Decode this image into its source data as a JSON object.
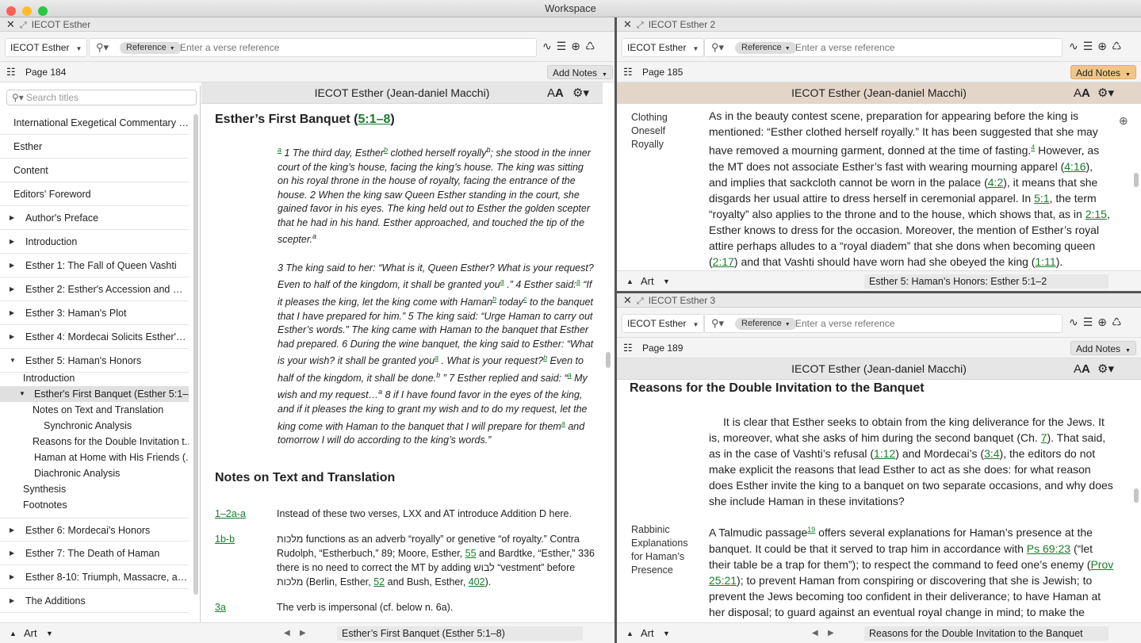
{
  "window": {
    "title": "Workspace"
  },
  "pane1": {
    "tab": "IECOT Esther",
    "resource": "IECOT Esther",
    "ref_pill": "Reference",
    "search_placeholder": "Enter a verse reference",
    "page": "Page 184",
    "add_notes": "Add Notes",
    "book_title": "IECOT Esther (Jean-daniel Macchi)",
    "sidebar": {
      "search_placeholder": "Search titles",
      "items": [
        "International Exegetical Commentary on...",
        "Esther",
        "Content",
        "Editors' Foreword",
        "Author's Preface",
        "Introduction",
        "Esther  1: The Fall of Queen Vashti",
        "Esther  2: Esther's Accession and Roy...",
        "Esther  3: Haman's Plot",
        "Esther  4: Mordecai Solicits Esther's...",
        "Esther  5: Haman's Honors"
      ],
      "sub": [
        "Introduction",
        "Esther's First Banquet (Esther 5:1–8)",
        "Notes on Text and Translation",
        "Synchronic Analysis",
        "Reasons for the Double Invitation t...",
        "Haman at Home with His Friends (...",
        "Diachronic Analysis",
        "Synthesis",
        "Footnotes"
      ],
      "items2": [
        "Esther  6: Mordecai's Honors",
        "Esther  7: The Death of Haman",
        "Esther  8-10: Triumph, Massacre, and...",
        "The Additions"
      ]
    },
    "heading": "Esther’s First Banquet (",
    "heading_ref": "5:1–8",
    "heading_end": ")",
    "verse_a": "1 The third day, Esther",
    "verse_a2": "clothed herself royally",
    "verse_a3": "; she stood in the inner court of the king’s house, facing the king’s house. The king was sitting on his royal throne in the house of royalty, facing the entrance of the house. 2 When the king saw Queen Esther standing in the court, she gained favor in his eyes. The king held out to Esther the golden scepter that he had in his hand. Esther approached, and touched the tip of the scepter.",
    "verse_b1": "3 The king said to her: “What is it, Queen Esther? What is your request? Even to half of the kingdom, it shall be granted you",
    "verse_b2": " .” 4 Esther said:",
    "verse_b3": " “If it pleases the king, let the king come with Haman",
    "verse_b4": " today",
    "verse_b5": " to the banquet that I have prepared for him.” 5 The king said: “Urge Haman to carry out Esther’s words.” The king came with Haman to the banquet that Esther had prepared. 6 During the wine banquet, the king said to Esther: “What is your wish? it shall be granted you",
    "verse_b6": " . What is your request?",
    "verse_b7": " Even to half of the kingdom, it shall be done.",
    "verse_b8": " ” 7 Esther replied and said: “",
    "verse_b9": " My wish and my request…",
    "verse_b10": " 8 if I have found favor in the eyes of the king, and if it pleases the king to grant my wish and to do my request, let the king come with Haman to the banquet that I will prepare for them",
    "verse_b11": " and tomorrow I will do according to the king’s words.”",
    "notes_heading": "Notes on Text and Translation",
    "n1_ref": "1–2a-a",
    "n1_txt": "Instead of these two verses, LXX and AT introduce Addition D here.",
    "n2_ref": "1b-b",
    "n2_txt1": "מלכות functions as an adverb “royally” or genetive “of royalty.” Contra Rudolph, “Estherbuch,” 89; Moore, Esther, ",
    "n2_l1": "55",
    "n2_txt2": " and Bardtke, “Esther,” 336 there is no need to correct the MT by adding לבוש “vestment” before מלכות (Berlin, Esther, ",
    "n2_l2": "52",
    "n2_txt3": " and Bush, Esther, ",
    "n2_l3": "402",
    "n2_txt4": ").",
    "n3_ref": "3a",
    "n3_txt": "The verb is impersonal (cf. below n. 6a).",
    "bottom_art": "Art",
    "bottom_nav": "Esther’s First Banquet (Esther 5:1–8)"
  },
  "pane2": {
    "tab": "IECOT Esther 2",
    "resource": "IECOT Esther",
    "ref_pill": "Reference",
    "search_placeholder": "Enter a verse reference",
    "page": "Page 185",
    "add_notes": "Add Notes",
    "book_title": "IECOT Esther (Jean-daniel Macchi)",
    "side": "Clothing Oneself Royally",
    "t1": "As in the beauty contest scene, preparation for appearing before the king is mentioned: “Esther clothed herself royally.” It has been suggested that she may have removed a mourning garment, donned at the time of fasting.",
    "fn": "4",
    "t2": " However, as the MT does not associate Esther’s fast with wearing mourning apparel (",
    "l1": "4:16",
    "t3": "), and implies that sackcloth cannot be worn in the palace (",
    "l2": "4:2",
    "t4": "), it means that she disgards her usual attire to dress herself in ceremonial apparel. In ",
    "l3": "5:1",
    "t5": ", the term “royalty” also applies to the throne and to the house, which shows that, as in ",
    "l4": "2:15",
    "t6": ", Esther knows to dress for the occasion. Moreover, the mention of Esther’s royal attire perhaps alludes to a “royal diadem” that she dons when becoming queen (",
    "l5": "2:17",
    "t7": ") and that Vashti should have worn had she obeyed the king (",
    "l6": "1:11",
    "t8": ").",
    "bottom_art": "Art",
    "bottom_nav": "Esther  5: Haman’s Honors: Esther 5:1–2"
  },
  "pane3": {
    "tab": "IECOT Esther 3",
    "resource": "IECOT Esther",
    "ref_pill": "Reference",
    "search_placeholder": "Enter a verse reference",
    "page": "Page 189",
    "add_notes": "Add Notes",
    "book_title": "IECOT Esther (Jean-daniel Macchi)",
    "heading": "Reasons for the Double Invitation to the Banquet",
    "p1a": "It is clear that Esther seeks to obtain from the king deliverance for the Jews. It is, moreover, what she asks of him during the second banquet (Ch. ",
    "p1l1": "7",
    "p1b": "). That said, as in the case of Vashti’s refusal (",
    "p1l2": "1:12",
    "p1c": ") and Mordecai’s (",
    "p1l3": "3:4",
    "p1d": "), the editors do not make explicit the reasons that lead Esther to act as she does: for what reason does Esther invite the king to a banquet on two separate occasions, and why does she include Haman in these invitations?",
    "side": "Rabbinic Explanations for Haman’s Presence",
    "p2a": "A Talmudic passage",
    "p2fn": "19",
    "p2b": " offers several explanations for Haman’s presence at the banquet. It could be that it served to trap him in accordance with ",
    "p2l1": "Ps 69:23",
    "p2c": " (“let their table be a trap for them”); to respect the command to feed one’s enemy (",
    "p2l2": "Prov 25:21",
    "p2d": "); to prevent Haman from conspiring or discovering that she is Jewish; to prevent the Jews becoming too confident in their deliverance; to have Haman at her disposal; to guard against an eventual royal change in mind; to make the",
    "bottom_art": "Art",
    "bottom_nav": "Reasons for the Double Invitation to the Banquet"
  }
}
